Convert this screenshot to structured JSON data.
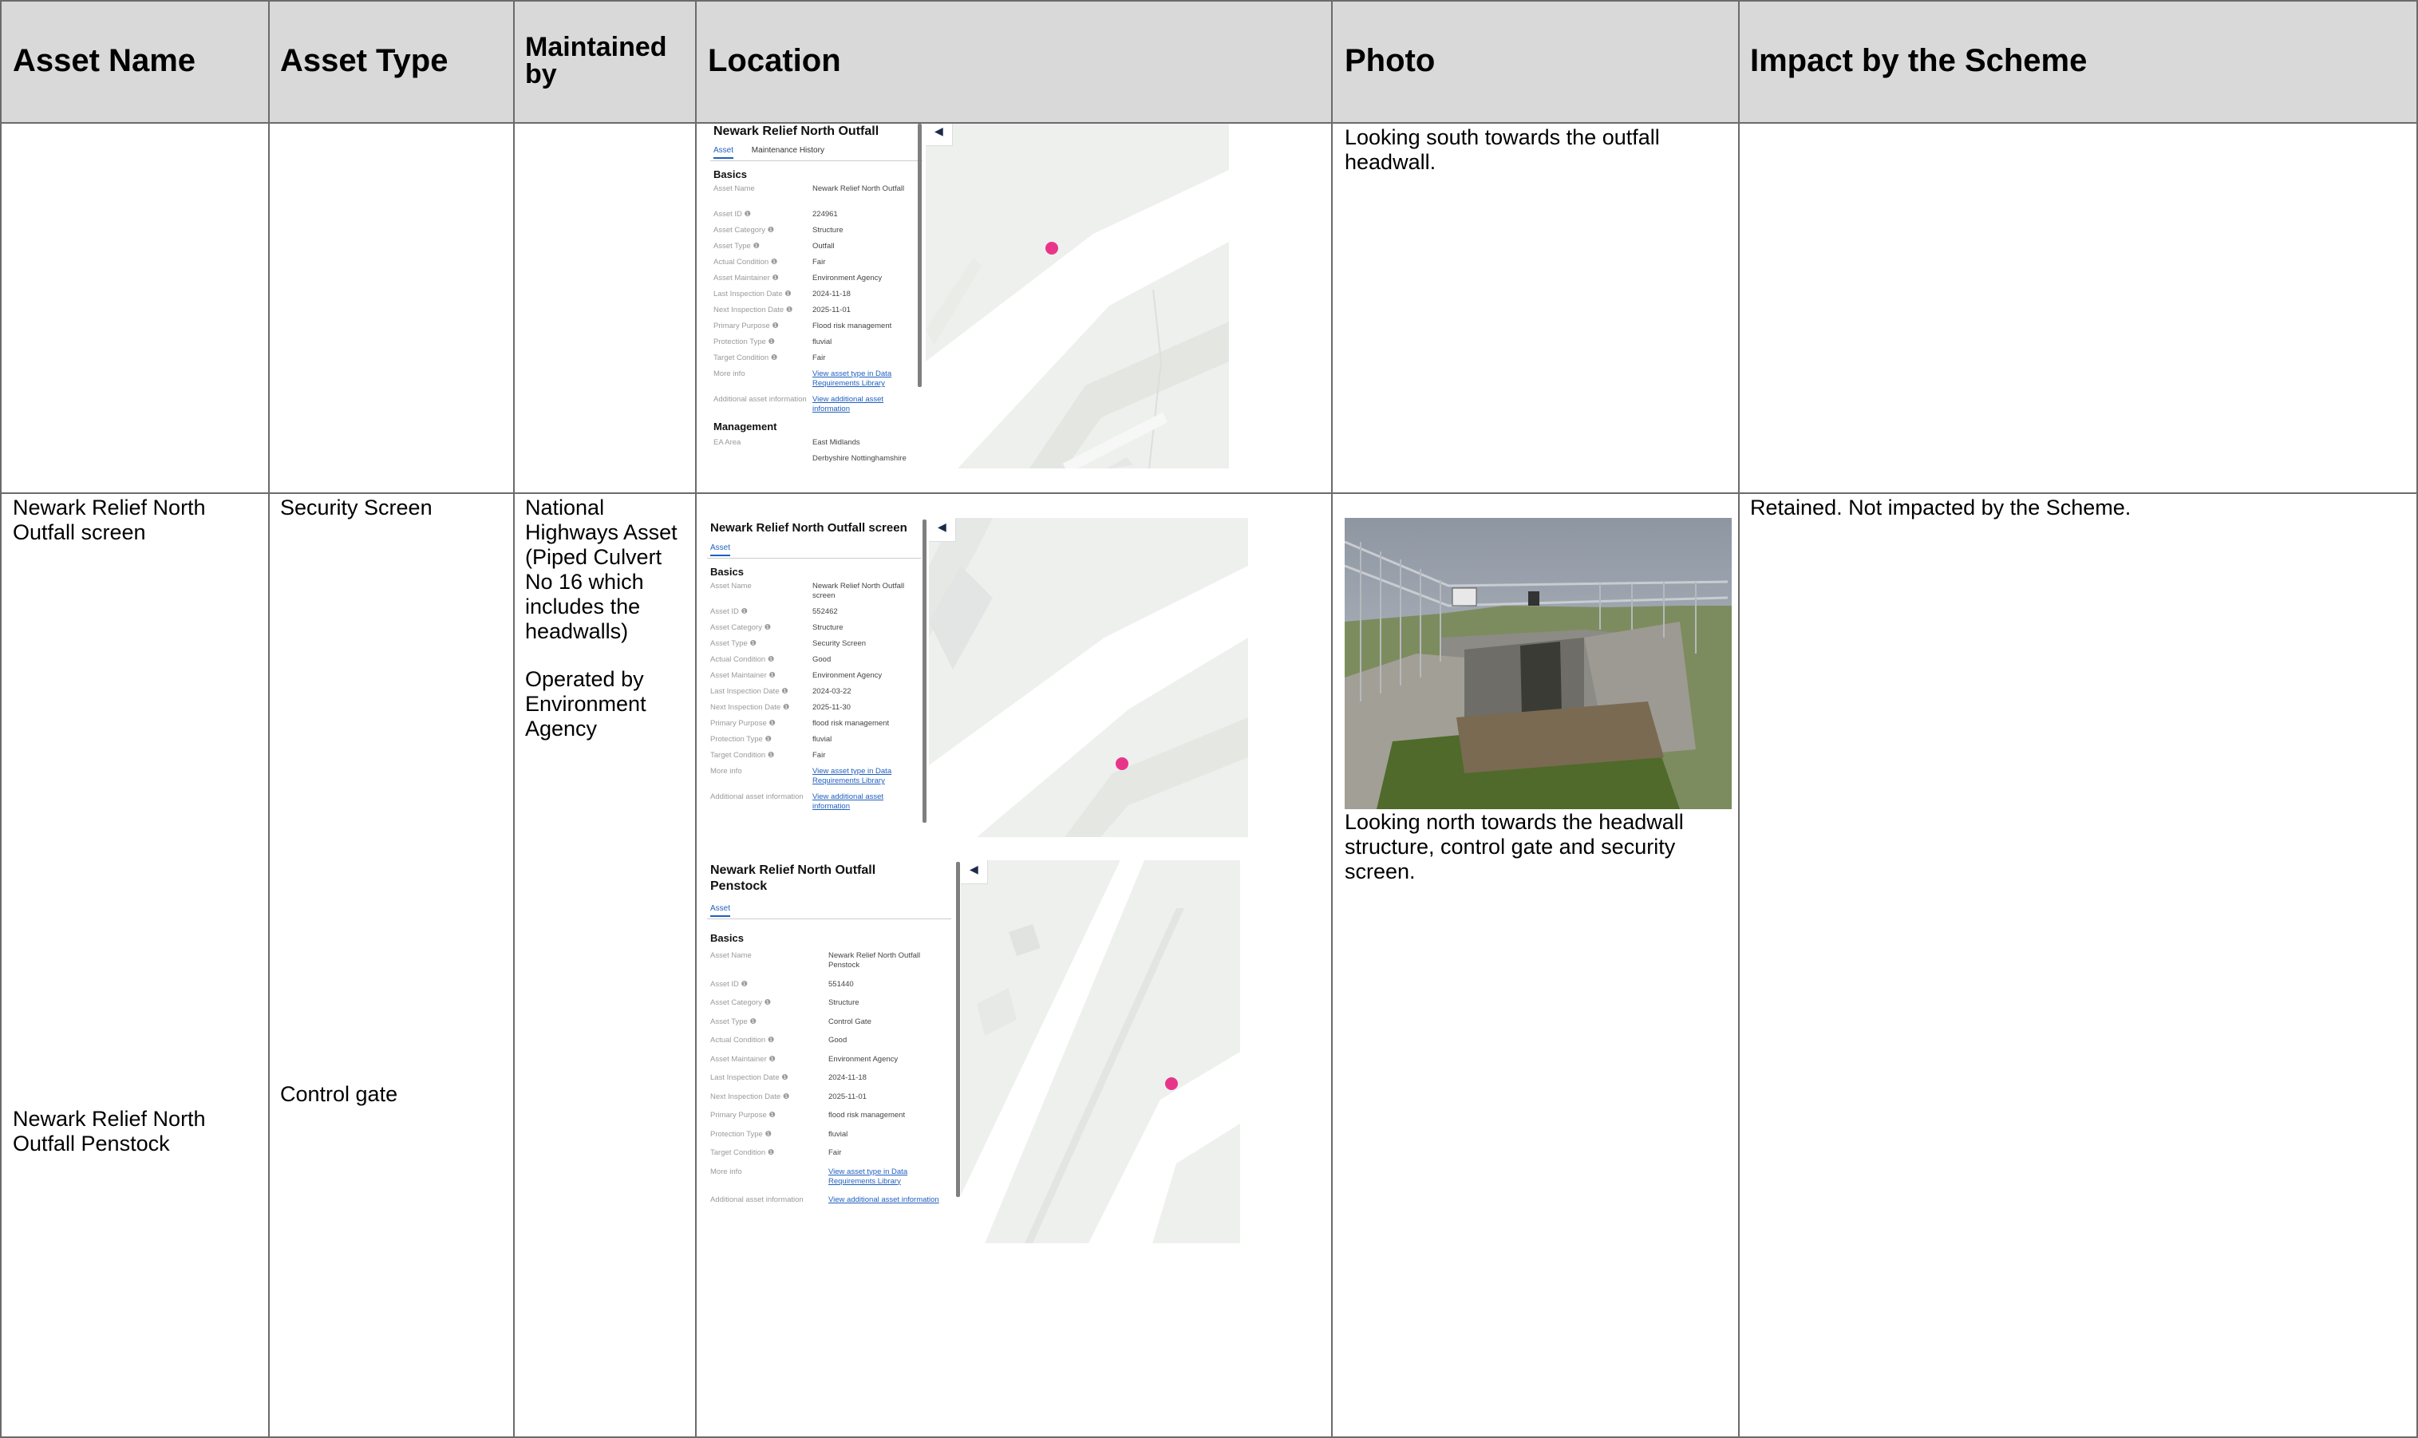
{
  "headers": {
    "asset_name": "Asset Name",
    "asset_type": "Asset Type",
    "maintained_by": "Maintained by",
    "location": "Location",
    "photo": "Photo",
    "impact": "Impact by the Scheme"
  },
  "row_prev": {
    "photo_caption": "Looking south towards the outfall headwall."
  },
  "row_main": {
    "asset_name_1": "Newark Relief North Outfall screen",
    "asset_name_2": "Newark Relief North Outfall Penstock",
    "asset_type_1": "Security Screen",
    "asset_type_2": "Control gate",
    "maintained_by_1": "National Highways Asset (Piped Culvert No 16 which includes the headwalls)",
    "maintained_by_2": "Operated by Environment Agency",
    "photo_caption": "Looking north towards the headwall structure, control gate and security screen.",
    "impact": "Retained.  Not impacted by the Scheme."
  },
  "cards": {
    "outfall": {
      "title": "Newark Relief North Outfall",
      "tab1": "Asset",
      "tab2": "Maintenance History",
      "basics": "Basics",
      "management": "Management",
      "fields": [
        {
          "k": "Asset Name",
          "v": "Newark Relief North Outfall"
        },
        {
          "k": "Asset ID ❶",
          "v": "224961"
        },
        {
          "k": "Asset Category ❶",
          "v": "Structure"
        },
        {
          "k": "Asset Type ❶",
          "v": "Outfall"
        },
        {
          "k": "Actual Condition ❶",
          "v": "Fair"
        },
        {
          "k": "Asset Maintainer ❶",
          "v": "Environment Agency"
        },
        {
          "k": "Last Inspection Date ❶",
          "v": "2024-11-18"
        },
        {
          "k": "Next Inspection Date ❶",
          "v": "2025-11-01"
        },
        {
          "k": "Primary Purpose ❶",
          "v": "Flood risk management"
        },
        {
          "k": "Protection Type ❶",
          "v": "fluvial"
        },
        {
          "k": "Target Condition ❶",
          "v": "Fair"
        },
        {
          "k": "More info",
          "v": "View asset type in Data Requirements Library"
        },
        {
          "k": "Additional asset information",
          "v": "View additional asset information"
        }
      ],
      "mgmt": [
        {
          "k": "EA Area",
          "v": "East Midlands"
        },
        {
          "k": "",
          "v": "Derbyshire Nottinghamshire"
        }
      ]
    },
    "screen": {
      "title": "Newark Relief North Outfall screen",
      "tab1": "Asset",
      "basics": "Basics",
      "fields": [
        {
          "k": "Asset Name",
          "v": "Newark Relief North Outfall screen"
        },
        {
          "k": "Asset ID ❶",
          "v": "552462"
        },
        {
          "k": "Asset Category ❶",
          "v": "Structure"
        },
        {
          "k": "Asset Type ❶",
          "v": "Security Screen"
        },
        {
          "k": "Actual Condition ❶",
          "v": "Good"
        },
        {
          "k": "Asset Maintainer ❶",
          "v": "Environment Agency"
        },
        {
          "k": "Last Inspection Date ❶",
          "v": "2024-03-22"
        },
        {
          "k": "Next Inspection Date ❶",
          "v": "2025-11-30"
        },
        {
          "k": "Primary Purpose ❶",
          "v": "flood risk management"
        },
        {
          "k": "Protection Type ❶",
          "v": "fluvial"
        },
        {
          "k": "Target Condition ❶",
          "v": "Fair"
        },
        {
          "k": "More info",
          "v": "View asset type in Data Requirements Library"
        },
        {
          "k": "Additional asset information",
          "v": "View additional asset information"
        }
      ]
    },
    "penstock": {
      "title": "Newark Relief North Outfall Penstock",
      "tab1": "Asset",
      "basics": "Basics",
      "fields": [
        {
          "k": "Asset Name",
          "v": "Newark Relief North Outfall Penstock"
        },
        {
          "k": "Asset ID ❶",
          "v": "551440"
        },
        {
          "k": "Asset Category ❶",
          "v": "Structure"
        },
        {
          "k": "Asset Type ❶",
          "v": "Control Gate"
        },
        {
          "k": "Actual Condition ❶",
          "v": "Good"
        },
        {
          "k": "Asset Maintainer ❶",
          "v": "Environment Agency"
        },
        {
          "k": "Last Inspection Date ❶",
          "v": "2024-11-18"
        },
        {
          "k": "Next Inspection Date ❶",
          "v": "2025-11-01"
        },
        {
          "k": "Primary Purpose ❶",
          "v": "flood risk management"
        },
        {
          "k": "Protection Type ❶",
          "v": "fluvial"
        },
        {
          "k": "Target Condition ❶",
          "v": "Fair"
        },
        {
          "k": "More info",
          "v": "View asset type in Data Requirements Library"
        },
        {
          "k": "Additional asset information",
          "v": "View additional asset information"
        }
      ]
    }
  },
  "colors": {
    "header_bg": "#d9d9d9",
    "grid": "#6b6b6b",
    "pin": "#e8358a",
    "link": "#1f5fbf"
  }
}
